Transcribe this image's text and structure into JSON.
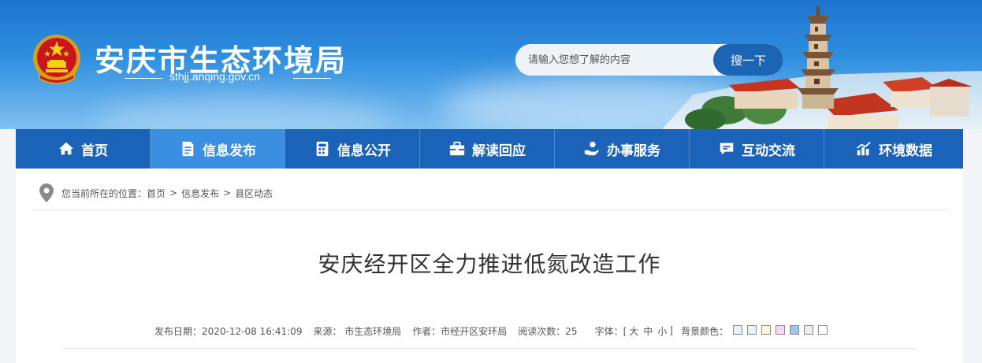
{
  "header": {
    "site_title": "安庆市生态环境局",
    "site_url": "sthjj.anqing.gov.cn",
    "emblem_icon": "national-emblem-icon"
  },
  "search": {
    "placeholder": "请输入您想了解的内容",
    "button_label": "搜一下"
  },
  "nav": {
    "items": [
      {
        "label": "首页",
        "icon": "home-icon"
      },
      {
        "label": "信息发布",
        "icon": "document-icon",
        "active": true
      },
      {
        "label": "信息公开",
        "icon": "calculator-icon"
      },
      {
        "label": "解读回应",
        "icon": "briefcase-icon"
      },
      {
        "label": "办事服务",
        "icon": "hand-service-icon"
      },
      {
        "label": "互动交流",
        "icon": "chat-icon"
      },
      {
        "label": "环境数据",
        "icon": "chart-icon"
      }
    ]
  },
  "breadcrumb": {
    "prefix": "您当前所在的位置：",
    "items": [
      "首页",
      "信息发布",
      "县区动态"
    ],
    "separator": ">"
  },
  "article": {
    "title": "安庆经开区全力推进低氮改造工作",
    "meta": {
      "date": "发布日期：2020-12-08 16:41:09",
      "source": "来源： 市生态环境局",
      "author": "作者：市经开区安环局",
      "views": "阅读次数：25",
      "font_label": "字体：[",
      "font_large": "大",
      "font_medium": "中",
      "font_small": "小",
      "font_close": "]",
      "bg_label": "背景颜色：",
      "bg_colors": [
        "#e6f3fa",
        "#e2f7f5",
        "#fbf8d8",
        "#f9d6f4",
        "#9cc7f2",
        "#eeeeee",
        "#ffffff"
      ]
    }
  },
  "colors": {
    "nav_bg": "#1b63b8",
    "nav_active": "#3b8fe0",
    "search_button": "#1c64b4"
  }
}
